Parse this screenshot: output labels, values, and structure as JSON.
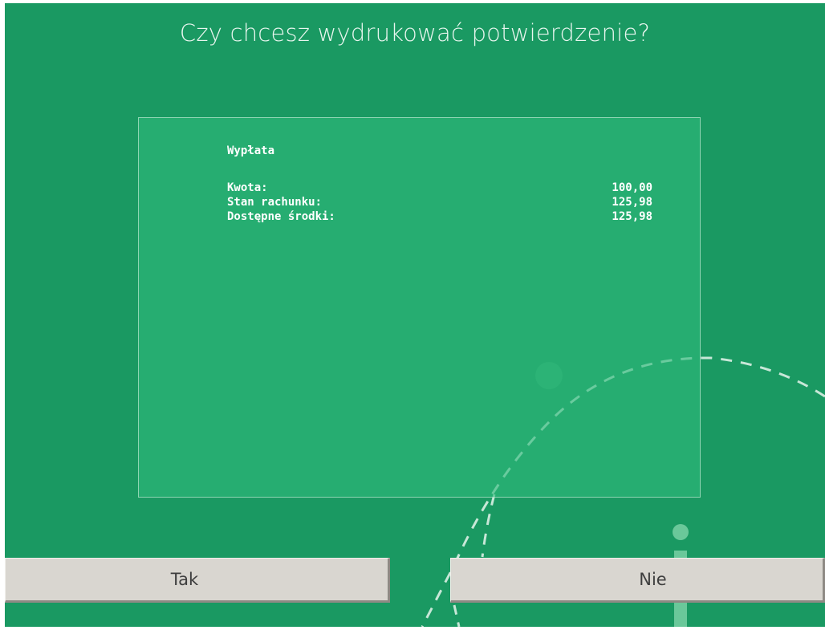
{
  "dialog": {
    "title": "Czy chcesz wydrukować potwierdzenie?"
  },
  "receipt": {
    "heading": "Wypłata",
    "rows": [
      {
        "label": "Kwota:",
        "value": "100,00"
      },
      {
        "label": "Stan rachunku:",
        "value": "125,98"
      },
      {
        "label": "Dostępne środki:",
        "value": "125,98"
      }
    ]
  },
  "buttons": {
    "yes_label": "Tak",
    "no_label": "Nie"
  },
  "colors": {
    "background": "#1a9962",
    "panel": "#2eb97a",
    "button": "#d9d6d0",
    "button_text": "#3e3e3e"
  }
}
